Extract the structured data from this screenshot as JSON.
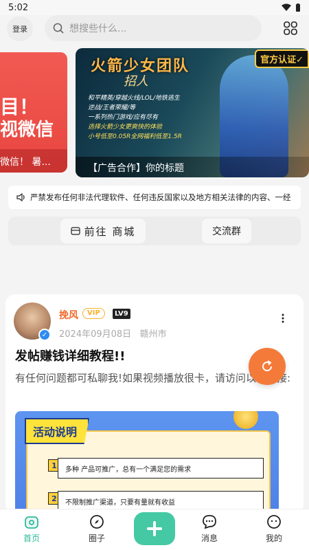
{
  "status": {
    "time": "5:02"
  },
  "header": {
    "login_label": "登录",
    "search_placeholder": "想搜些什么..."
  },
  "banners": {
    "left": {
      "line1": "目！",
      "line2": "视微信",
      "caption": "微信！ 暑..."
    },
    "main": {
      "title": "火箭少女团队",
      "subtitle": "招人",
      "badge": "官方认证✓",
      "lines": [
        "和平精英/穿越火线/LOL/地铁逃生",
        "逆战/王者荣耀/等",
        "一系列热门游戏/应有尽有",
        "选择火箭少女更爽快的体验",
        "小号低至0.05R全网福利低至1.5R"
      ],
      "caption": "【广告合作】你的标题"
    }
  },
  "notice": {
    "text": "严禁发布任何非法代理软件、任何违反国家以及地方相关法律的内容、一经"
  },
  "quick_nav": {
    "shop_label": "前往 商城",
    "group_label": "交流群"
  },
  "post": {
    "username": "挽风",
    "vip": "VIP",
    "level": "LV9",
    "date": "2024年09月08日",
    "location": "赣州市",
    "title": "发帖赚钱详细教程!!",
    "body": "有任何问题都可私聊我!如果视频播放很卡，请访问以下链接:",
    "promo": {
      "tag": "活动说明",
      "item1_num": "1",
      "item1": "多种 产品可推广，总有一个满足您的需求",
      "item2_num": "2",
      "item2": "不限制推广渠道，只要有量就有收益"
    }
  },
  "tabs": [
    {
      "label": "首页",
      "icon": "home-icon"
    },
    {
      "label": "圈子",
      "icon": "compass-icon"
    },
    {
      "label": "",
      "icon": "plus-icon"
    },
    {
      "label": "消息",
      "icon": "chat-icon"
    },
    {
      "label": "我的",
      "icon": "face-icon"
    }
  ],
  "colors": {
    "accent": "#2fb99a",
    "fab": "#f47a3a",
    "username": "#f06a2c"
  }
}
